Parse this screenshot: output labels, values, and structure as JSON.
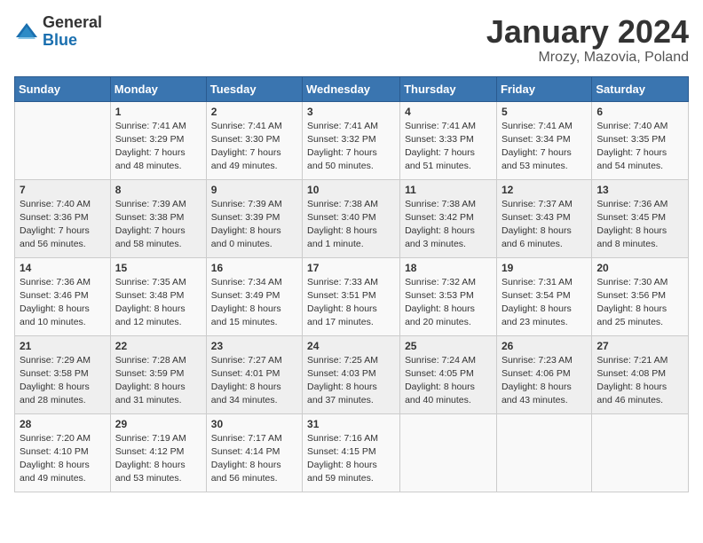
{
  "logo": {
    "general": "General",
    "blue": "Blue"
  },
  "title": "January 2024",
  "location": "Mrozy, Mazovia, Poland",
  "days_of_week": [
    "Sunday",
    "Monday",
    "Tuesday",
    "Wednesday",
    "Thursday",
    "Friday",
    "Saturday"
  ],
  "weeks": [
    [
      {
        "day": "",
        "info": ""
      },
      {
        "day": "1",
        "info": "Sunrise: 7:41 AM\nSunset: 3:29 PM\nDaylight: 7 hours\nand 48 minutes."
      },
      {
        "day": "2",
        "info": "Sunrise: 7:41 AM\nSunset: 3:30 PM\nDaylight: 7 hours\nand 49 minutes."
      },
      {
        "day": "3",
        "info": "Sunrise: 7:41 AM\nSunset: 3:32 PM\nDaylight: 7 hours\nand 50 minutes."
      },
      {
        "day": "4",
        "info": "Sunrise: 7:41 AM\nSunset: 3:33 PM\nDaylight: 7 hours\nand 51 minutes."
      },
      {
        "day": "5",
        "info": "Sunrise: 7:41 AM\nSunset: 3:34 PM\nDaylight: 7 hours\nand 53 minutes."
      },
      {
        "day": "6",
        "info": "Sunrise: 7:40 AM\nSunset: 3:35 PM\nDaylight: 7 hours\nand 54 minutes."
      }
    ],
    [
      {
        "day": "7",
        "info": "Sunrise: 7:40 AM\nSunset: 3:36 PM\nDaylight: 7 hours\nand 56 minutes."
      },
      {
        "day": "8",
        "info": "Sunrise: 7:39 AM\nSunset: 3:38 PM\nDaylight: 7 hours\nand 58 minutes."
      },
      {
        "day": "9",
        "info": "Sunrise: 7:39 AM\nSunset: 3:39 PM\nDaylight: 8 hours\nand 0 minutes."
      },
      {
        "day": "10",
        "info": "Sunrise: 7:38 AM\nSunset: 3:40 PM\nDaylight: 8 hours\nand 1 minute."
      },
      {
        "day": "11",
        "info": "Sunrise: 7:38 AM\nSunset: 3:42 PM\nDaylight: 8 hours\nand 3 minutes."
      },
      {
        "day": "12",
        "info": "Sunrise: 7:37 AM\nSunset: 3:43 PM\nDaylight: 8 hours\nand 6 minutes."
      },
      {
        "day": "13",
        "info": "Sunrise: 7:36 AM\nSunset: 3:45 PM\nDaylight: 8 hours\nand 8 minutes."
      }
    ],
    [
      {
        "day": "14",
        "info": "Sunrise: 7:36 AM\nSunset: 3:46 PM\nDaylight: 8 hours\nand 10 minutes."
      },
      {
        "day": "15",
        "info": "Sunrise: 7:35 AM\nSunset: 3:48 PM\nDaylight: 8 hours\nand 12 minutes."
      },
      {
        "day": "16",
        "info": "Sunrise: 7:34 AM\nSunset: 3:49 PM\nDaylight: 8 hours\nand 15 minutes."
      },
      {
        "day": "17",
        "info": "Sunrise: 7:33 AM\nSunset: 3:51 PM\nDaylight: 8 hours\nand 17 minutes."
      },
      {
        "day": "18",
        "info": "Sunrise: 7:32 AM\nSunset: 3:53 PM\nDaylight: 8 hours\nand 20 minutes."
      },
      {
        "day": "19",
        "info": "Sunrise: 7:31 AM\nSunset: 3:54 PM\nDaylight: 8 hours\nand 23 minutes."
      },
      {
        "day": "20",
        "info": "Sunrise: 7:30 AM\nSunset: 3:56 PM\nDaylight: 8 hours\nand 25 minutes."
      }
    ],
    [
      {
        "day": "21",
        "info": "Sunrise: 7:29 AM\nSunset: 3:58 PM\nDaylight: 8 hours\nand 28 minutes."
      },
      {
        "day": "22",
        "info": "Sunrise: 7:28 AM\nSunset: 3:59 PM\nDaylight: 8 hours\nand 31 minutes."
      },
      {
        "day": "23",
        "info": "Sunrise: 7:27 AM\nSunset: 4:01 PM\nDaylight: 8 hours\nand 34 minutes."
      },
      {
        "day": "24",
        "info": "Sunrise: 7:25 AM\nSunset: 4:03 PM\nDaylight: 8 hours\nand 37 minutes."
      },
      {
        "day": "25",
        "info": "Sunrise: 7:24 AM\nSunset: 4:05 PM\nDaylight: 8 hours\nand 40 minutes."
      },
      {
        "day": "26",
        "info": "Sunrise: 7:23 AM\nSunset: 4:06 PM\nDaylight: 8 hours\nand 43 minutes."
      },
      {
        "day": "27",
        "info": "Sunrise: 7:21 AM\nSunset: 4:08 PM\nDaylight: 8 hours\nand 46 minutes."
      }
    ],
    [
      {
        "day": "28",
        "info": "Sunrise: 7:20 AM\nSunset: 4:10 PM\nDaylight: 8 hours\nand 49 minutes."
      },
      {
        "day": "29",
        "info": "Sunrise: 7:19 AM\nSunset: 4:12 PM\nDaylight: 8 hours\nand 53 minutes."
      },
      {
        "day": "30",
        "info": "Sunrise: 7:17 AM\nSunset: 4:14 PM\nDaylight: 8 hours\nand 56 minutes."
      },
      {
        "day": "31",
        "info": "Sunrise: 7:16 AM\nSunset: 4:15 PM\nDaylight: 8 hours\nand 59 minutes."
      },
      {
        "day": "",
        "info": ""
      },
      {
        "day": "",
        "info": ""
      },
      {
        "day": "",
        "info": ""
      }
    ]
  ]
}
